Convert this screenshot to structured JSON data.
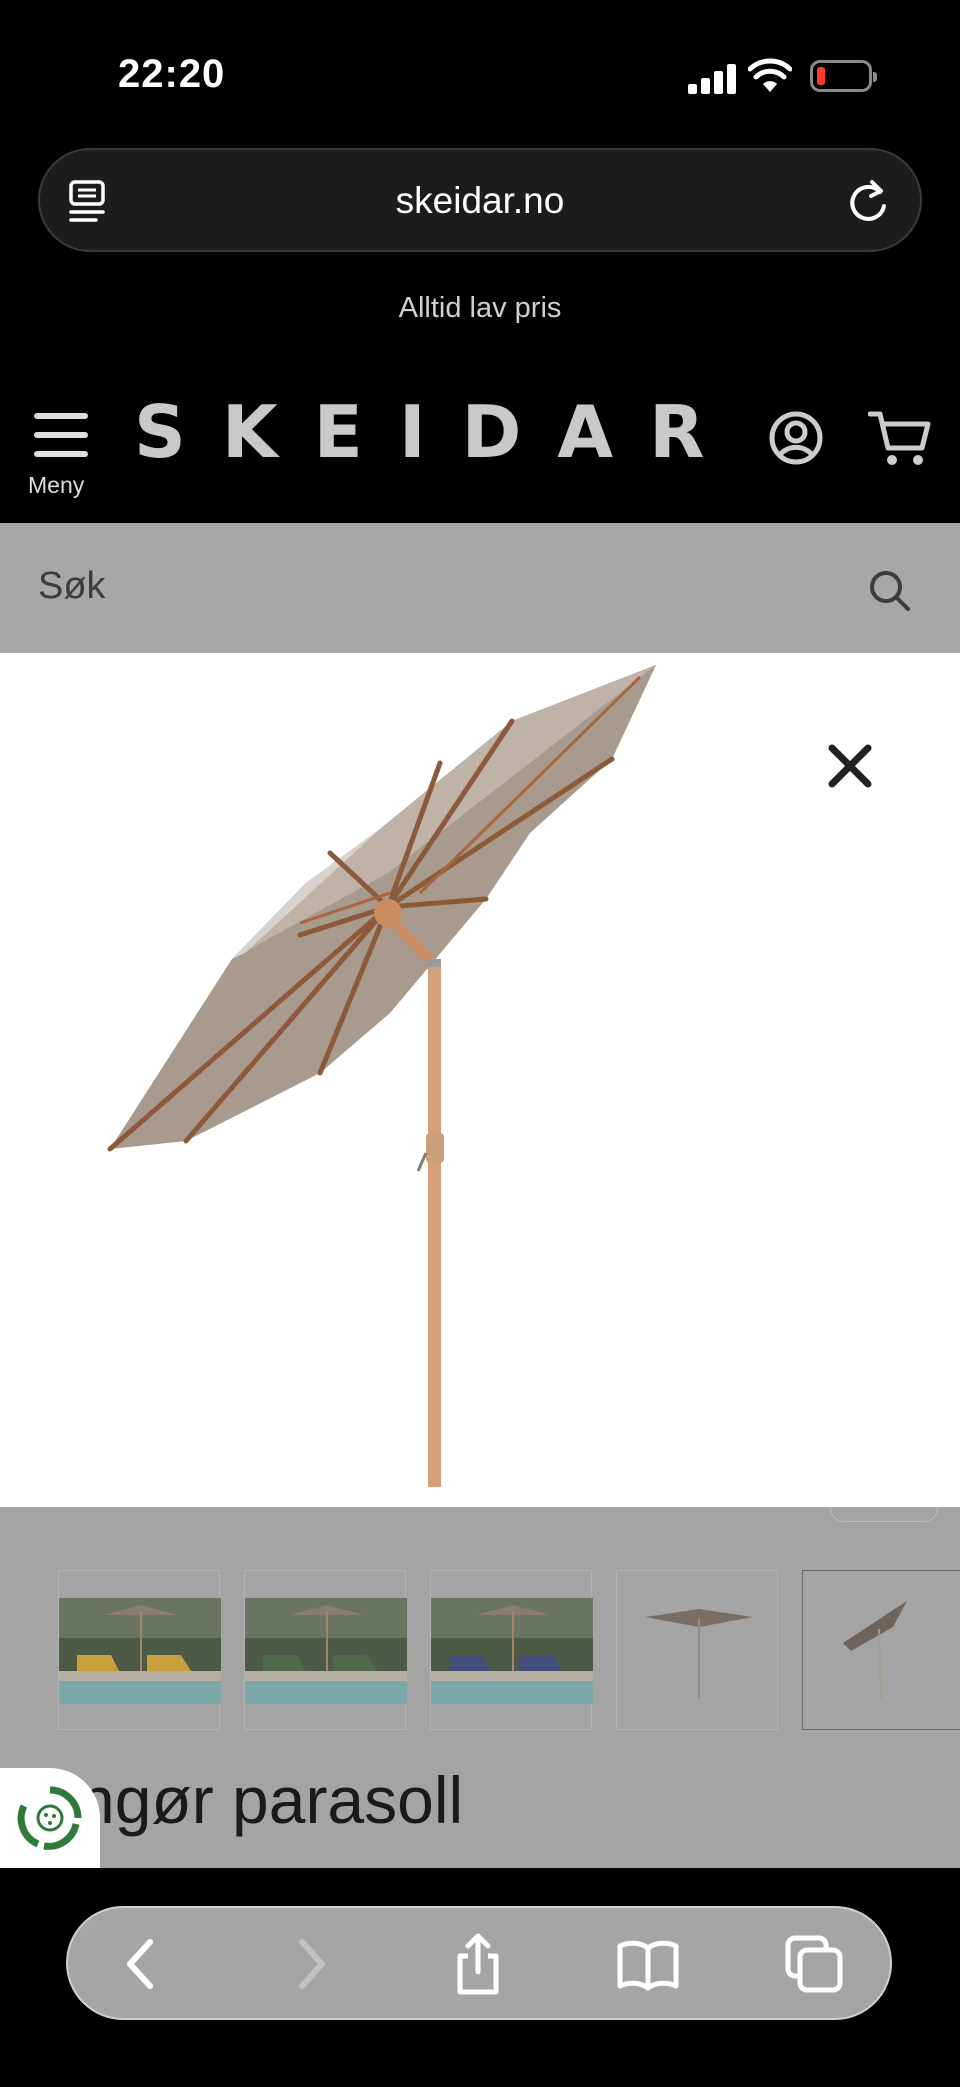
{
  "status_bar": {
    "time": "22:20"
  },
  "browser": {
    "url": "skeidar.no"
  },
  "site": {
    "promo_text": "Alltid lav pris",
    "menu_label": "Meny",
    "logo_text": "SKEIDAR",
    "search_placeholder": "Søk"
  },
  "product": {
    "title_visible": "ngør parasoll",
    "thumbnails": [
      "yellow-loungers",
      "green-loungers",
      "blue-loungers",
      "parasol-open",
      "parasol-tilted"
    ],
    "selected_thumbnail": 4
  },
  "colors": {
    "header_bg": "#000000",
    "search_bg": "#a7a7a7",
    "parasol_canopy": "#a89a8c",
    "parasol_pole": "#d4a07a",
    "battery_low": "#ff3b30"
  }
}
